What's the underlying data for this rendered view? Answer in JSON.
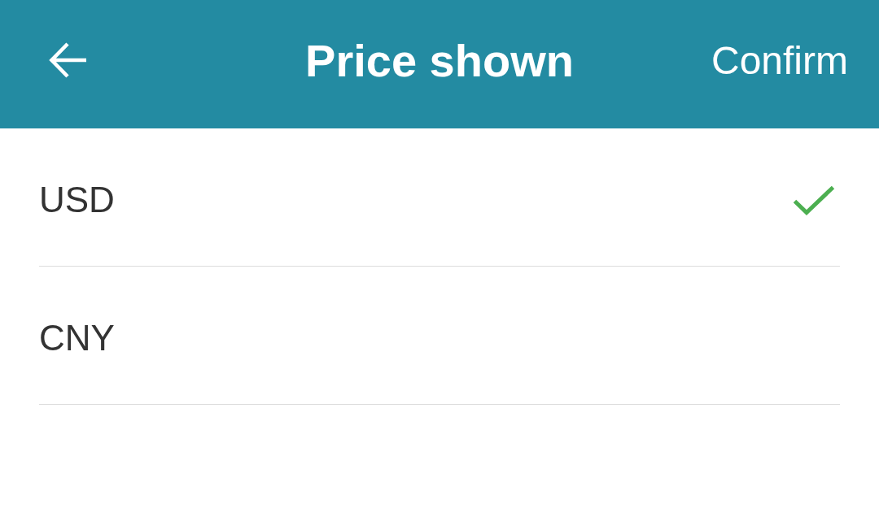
{
  "header": {
    "title": "Price shown",
    "action": "Confirm"
  },
  "options": [
    {
      "label": "USD",
      "selected": true
    },
    {
      "label": "CNY",
      "selected": false
    }
  ]
}
